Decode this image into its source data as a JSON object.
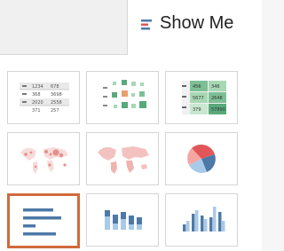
{
  "header": {
    "title": "Show Me",
    "icon": "show-me-bars-icon",
    "icon_colors": [
      "#4e79a7",
      "#e15759",
      "#4e79a7"
    ]
  },
  "chart_types": [
    {
      "name": "text-table",
      "selected": false,
      "values": [
        "1234",
        "678",
        "368",
        "3698",
        "2020",
        "2558",
        "371",
        "257"
      ]
    },
    {
      "name": "heat-map",
      "selected": false
    },
    {
      "name": "highlight-table",
      "selected": false,
      "values": [
        "456",
        "346",
        "5677",
        "2648",
        "379",
        "57890"
      ]
    },
    {
      "name": "symbol-map",
      "selected": false
    },
    {
      "name": "filled-map",
      "selected": false
    },
    {
      "name": "pie-chart",
      "selected": false
    },
    {
      "name": "horizontal-bars",
      "selected": true
    },
    {
      "name": "stacked-bars",
      "selected": false
    },
    {
      "name": "side-by-side-bars",
      "selected": false
    }
  ],
  "colors": {
    "selected_border": "#d06a3c",
    "bar_blue": "#4e79a7",
    "light_blue": "#a9c9e8",
    "green": "#59a97b",
    "light_green": "#a7d8b4",
    "map_pink": "#f3c2c0"
  }
}
